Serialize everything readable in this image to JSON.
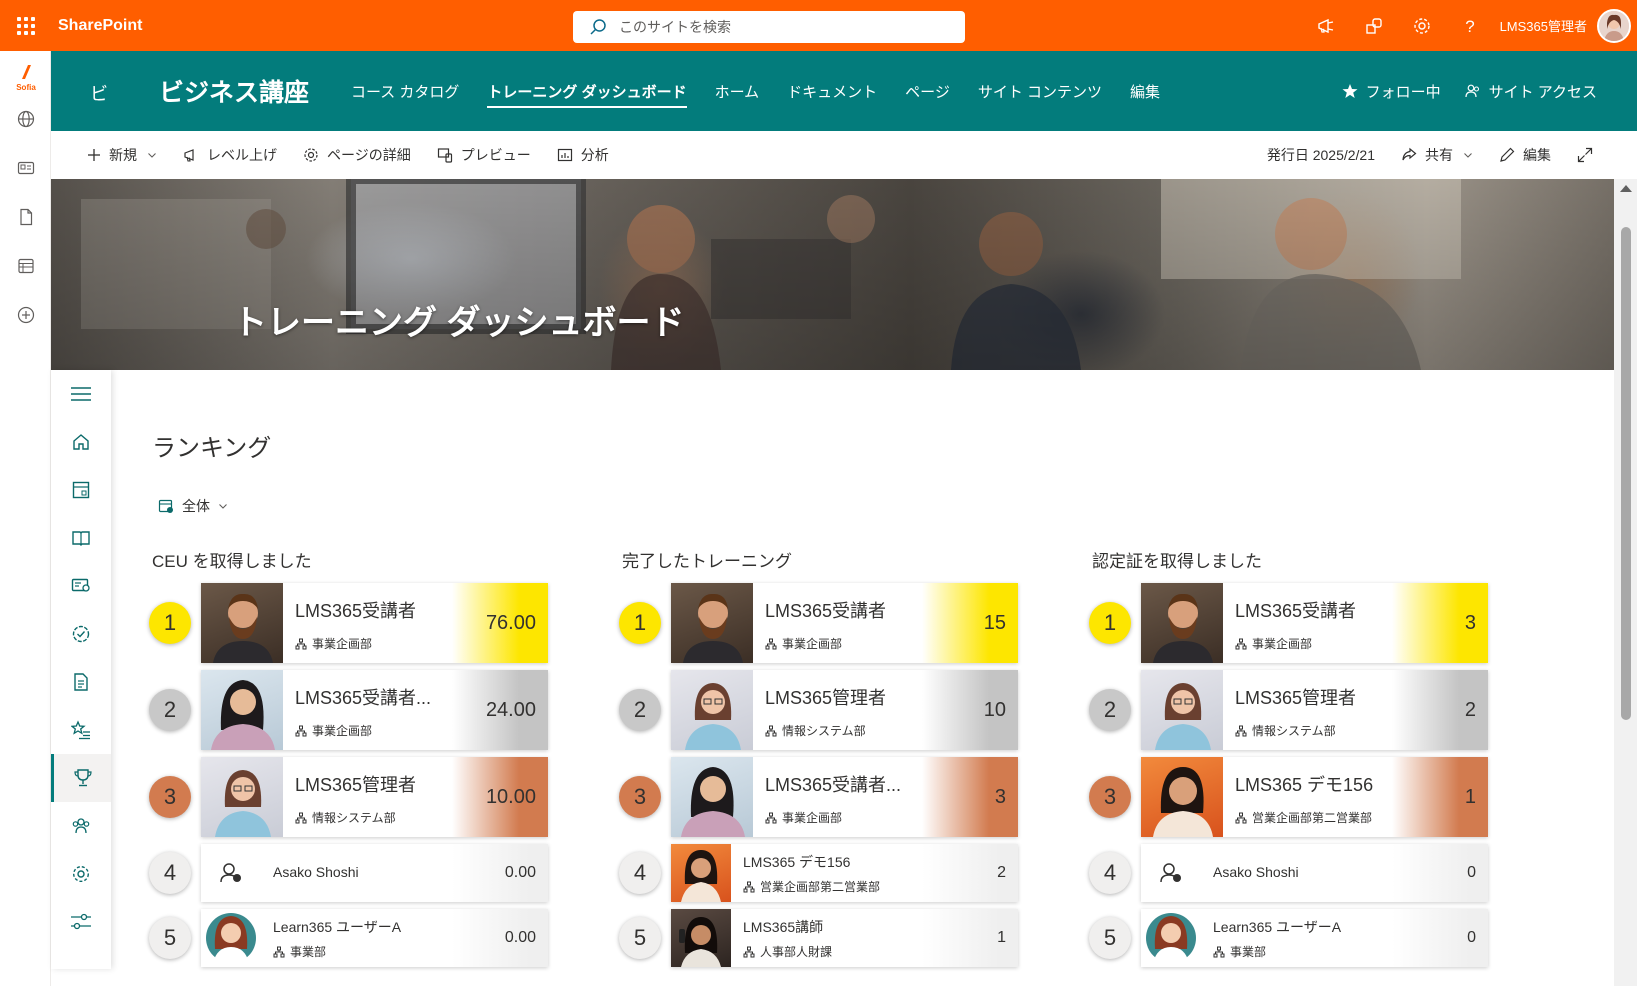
{
  "suite": {
    "brand": "SharePoint",
    "search_placeholder": "このサイトを検索",
    "user_name": "LMS365管理者"
  },
  "site": {
    "logo_text": "ビ",
    "title": "ビジネス講座",
    "nav": [
      "コース カタログ",
      "トレーニング ダッシュボード",
      "ホーム",
      "ドキュメント",
      "ページ",
      "サイト コンテンツ",
      "編集"
    ],
    "follow_label": "フォロー中",
    "access_label": "サイト アクセス"
  },
  "commands": {
    "new": "新規",
    "promote": "レベル上げ",
    "page_details": "ページの詳細",
    "preview": "プレビュー",
    "analytics": "分析",
    "published": "発行日 2025/2/21",
    "share": "共有",
    "edit": "編集"
  },
  "hero": {
    "title": "トレーニング ダッシュボード"
  },
  "page": {
    "heading": "ランキング",
    "filter": "全体"
  },
  "boards": [
    {
      "title": "CEU を取得しました",
      "rows": [
        {
          "rank": "1",
          "name": "LMS365受講者",
          "dept": "事業企画部",
          "score": "76.00"
        },
        {
          "rank": "2",
          "name": "LMS365受講者...",
          "dept": "事業企画部",
          "score": "24.00"
        },
        {
          "rank": "3",
          "name": "LMS365管理者",
          "dept": "情報システム部",
          "score": "10.00"
        },
        {
          "rank": "4",
          "name": "Asako Shoshi",
          "dept": "",
          "score": "0.00"
        },
        {
          "rank": "5",
          "name": "Learn365 ユーザーA",
          "dept": "事業部",
          "score": "0.00"
        }
      ]
    },
    {
      "title": "完了したトレーニング",
      "rows": [
        {
          "rank": "1",
          "name": "LMS365受講者",
          "dept": "事業企画部",
          "score": "15"
        },
        {
          "rank": "2",
          "name": "LMS365管理者",
          "dept": "情報システム部",
          "score": "10"
        },
        {
          "rank": "3",
          "name": "LMS365受講者...",
          "dept": "事業企画部",
          "score": "3"
        },
        {
          "rank": "4",
          "name": "LMS365 デモ156",
          "dept": "営業企画部第二営業部",
          "score": "2"
        },
        {
          "rank": "5",
          "name": "LMS365講師",
          "dept": "人事部人財課",
          "score": "1"
        }
      ]
    },
    {
      "title": "認定証を取得しました",
      "rows": [
        {
          "rank": "1",
          "name": "LMS365受講者",
          "dept": "事業企画部",
          "score": "3"
        },
        {
          "rank": "2",
          "name": "LMS365管理者",
          "dept": "情報システム部",
          "score": "2"
        },
        {
          "rank": "3",
          "name": "LMS365 デモ156",
          "dept": "営業企画部第二営業部",
          "score": "1"
        },
        {
          "rank": "4",
          "name": "Asako Shoshi",
          "dept": "",
          "score": "0"
        },
        {
          "rank": "5",
          "name": "Learn365 ユーザーA",
          "dept": "事業部",
          "score": "0"
        }
      ]
    }
  ],
  "colors": {
    "suite_orange": "#ff5e00",
    "site_teal": "#037c7c",
    "gold": "#fde600",
    "silver": "#c4c4c4",
    "bronze": "#d27b4f"
  }
}
